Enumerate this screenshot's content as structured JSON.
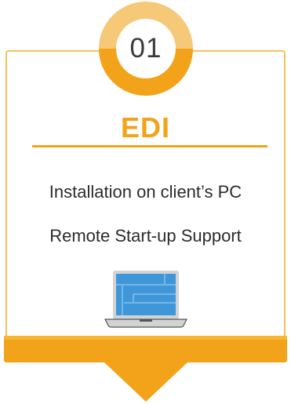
{
  "badge": {
    "number": "01",
    "ring_color_light": "#f6c979",
    "ring_color_dark": "#f2a31a"
  },
  "card": {
    "title": "EDI",
    "accent_color": "#f2a31a",
    "border_color": "#f6c15a",
    "lines": [
      "Installation on client’s PC",
      "Remote Start-up Support"
    ],
    "icon": "laptop-icon"
  }
}
